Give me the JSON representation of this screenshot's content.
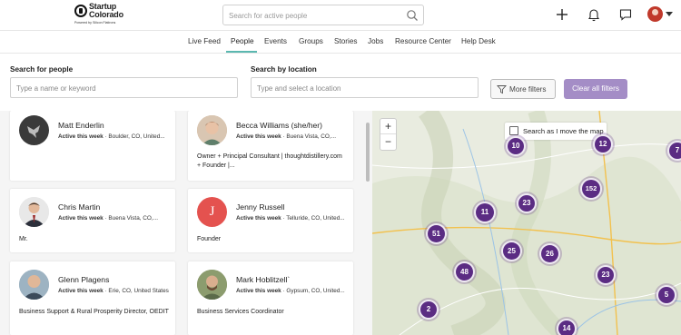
{
  "brand": {
    "line1": "Startup",
    "line2": "Colorado",
    "line3": "Powered by Silicon Flatirons"
  },
  "search": {
    "placeholder": "Search for active people"
  },
  "nav": {
    "tabs": [
      {
        "label": "Live Feed"
      },
      {
        "label": "People"
      },
      {
        "label": "Events"
      },
      {
        "label": "Groups"
      },
      {
        "label": "Stories"
      },
      {
        "label": "Jobs"
      },
      {
        "label": "Resource Center"
      },
      {
        "label": "Help Desk"
      }
    ],
    "active": "People"
  },
  "filters": {
    "people_label": "Search for people",
    "people_placeholder": "Type a name or keyword",
    "location_label": "Search by location",
    "location_placeholder": "Type and select a location",
    "more_filters": "More filters",
    "clear_all": "Clear all filters"
  },
  "people": [
    {
      "name": "Matt Enderlin",
      "activity": "Active this week",
      "location": " · Boulder, CO, United...",
      "bio": ""
    },
    {
      "name": "Becca Williams (she/her)",
      "activity": "Active this week",
      "location": " · Buena Vista, CO,...",
      "bio": "Owner + Principal Consultant | thoughtdistillery.com + Founder |..."
    },
    {
      "name": "Chris Martin",
      "activity": "Active this week",
      "location": " · Buena Vista, CO,...",
      "bio": "Mr."
    },
    {
      "name": "Jenny Russell",
      "activity": "Active this week",
      "location": " · Telluride, CO, United...",
      "bio": "Founder",
      "initial": "J"
    },
    {
      "name": "Glenn Plagens",
      "activity": "Active this week",
      "location": " · Erie, CO, United States",
      "bio": "Business Support & Rural Prosperity Director, OEDIT"
    },
    {
      "name": "Mark Hoblitzell`",
      "activity": "Active this week",
      "location": " · Gypsum, CO, United...",
      "bio": "Business Services Coordinator"
    }
  ],
  "map": {
    "zoom_in": "+",
    "zoom_out": "−",
    "search_as_move": "Search as I move the map",
    "clusters": [
      "10",
      "12",
      "7",
      "152",
      "23",
      "11",
      "51",
      "25",
      "26",
      "48",
      "23",
      "5",
      "2",
      "14"
    ]
  },
  "colors": {
    "accent": "#5b2c83",
    "clear_button": "#a48dc6",
    "nav_underline": "#5bb8b0"
  }
}
